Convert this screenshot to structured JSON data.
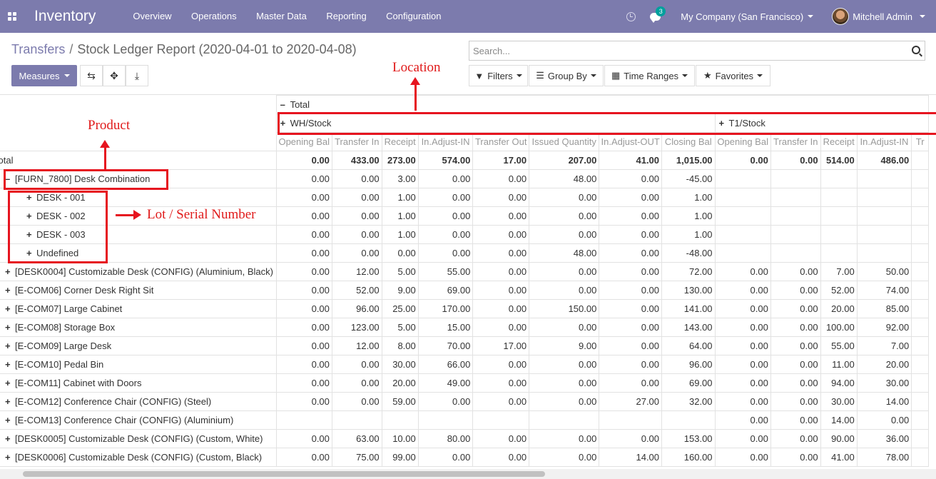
{
  "navbar": {
    "brand": "Inventory",
    "menu": [
      "Overview",
      "Operations",
      "Master Data",
      "Reporting",
      "Configuration"
    ],
    "chat_count": "3",
    "company": "My Company (San Francisco)",
    "user": "Mitchell Admin",
    "colors": {
      "bar": "#7c7bad",
      "badge": "#00a09d"
    }
  },
  "breadcrumb": {
    "parent": "Transfers",
    "sep": "/",
    "current": "Stock Ledger Report (2020-04-01 to 2020-04-08)"
  },
  "search": {
    "placeholder": "Search..."
  },
  "buttons": {
    "measures": "Measures",
    "filters": "Filters",
    "group_by": "Group By",
    "time_ranges": "Time Ranges",
    "favorites": "Favorites"
  },
  "annotations": {
    "location": "Location",
    "product": "Product",
    "lot": "Lot / Serial Number",
    "color": "#e6141f"
  },
  "pivot": {
    "total_header": "Total",
    "locations": [
      "WH/Stock",
      "T1/Stock"
    ],
    "measures_wh": [
      "Opening Bal",
      "Transfer In",
      "Receipt",
      "In.Adjust-IN",
      "Transfer Out",
      "Issued Quantity",
      "In.Adjust-OUT",
      "Closing Bal"
    ],
    "measures_t1": [
      "Opening Bal",
      "Transfer In",
      "Receipt",
      "In.Adjust-IN",
      "Tr"
    ],
    "total_row": {
      "label": "Total",
      "wh": [
        "0.00",
        "433.00",
        "273.00",
        "574.00",
        "17.00",
        "207.00",
        "41.00",
        "1,015.00"
      ],
      "t1": [
        "0.00",
        "0.00",
        "514.00",
        "486.00",
        ""
      ]
    },
    "rows": [
      {
        "label": "[FURN_7800] Desk Combination",
        "expanded": true,
        "level": 0,
        "wh": [
          "0.00",
          "0.00",
          "3.00",
          "0.00",
          "0.00",
          "48.00",
          "0.00",
          "-45.00"
        ],
        "t1": [
          "",
          "",
          "",
          "",
          ""
        ]
      },
      {
        "label": "DESK - 001",
        "level": 1,
        "wh": [
          "0.00",
          "0.00",
          "1.00",
          "0.00",
          "0.00",
          "0.00",
          "0.00",
          "1.00"
        ],
        "t1": [
          "",
          "",
          "",
          "",
          ""
        ]
      },
      {
        "label": "DESK - 002",
        "level": 1,
        "wh": [
          "0.00",
          "0.00",
          "1.00",
          "0.00",
          "0.00",
          "0.00",
          "0.00",
          "1.00"
        ],
        "t1": [
          "",
          "",
          "",
          "",
          ""
        ]
      },
      {
        "label": "DESK - 003",
        "level": 1,
        "wh": [
          "0.00",
          "0.00",
          "1.00",
          "0.00",
          "0.00",
          "0.00",
          "0.00",
          "1.00"
        ],
        "t1": [
          "",
          "",
          "",
          "",
          ""
        ]
      },
      {
        "label": "Undefined",
        "level": 1,
        "wh": [
          "0.00",
          "0.00",
          "0.00",
          "0.00",
          "0.00",
          "48.00",
          "0.00",
          "-48.00"
        ],
        "t1": [
          "",
          "",
          "",
          "",
          ""
        ]
      },
      {
        "label": "[DESK0004] Customizable Desk (CONFIG) (Aluminium, Black)",
        "level": 0,
        "wh": [
          "0.00",
          "12.00",
          "5.00",
          "55.00",
          "0.00",
          "0.00",
          "0.00",
          "72.00"
        ],
        "t1": [
          "0.00",
          "0.00",
          "7.00",
          "50.00",
          ""
        ]
      },
      {
        "label": "[E-COM06] Corner Desk Right Sit",
        "level": 0,
        "wh": [
          "0.00",
          "52.00",
          "9.00",
          "69.00",
          "0.00",
          "0.00",
          "0.00",
          "130.00"
        ],
        "t1": [
          "0.00",
          "0.00",
          "52.00",
          "74.00",
          ""
        ]
      },
      {
        "label": "[E-COM07] Large Cabinet",
        "level": 0,
        "wh": [
          "0.00",
          "96.00",
          "25.00",
          "170.00",
          "0.00",
          "150.00",
          "0.00",
          "141.00"
        ],
        "t1": [
          "0.00",
          "0.00",
          "20.00",
          "85.00",
          ""
        ]
      },
      {
        "label": "[E-COM08] Storage Box",
        "level": 0,
        "wh": [
          "0.00",
          "123.00",
          "5.00",
          "15.00",
          "0.00",
          "0.00",
          "0.00",
          "143.00"
        ],
        "t1": [
          "0.00",
          "0.00",
          "100.00",
          "92.00",
          ""
        ]
      },
      {
        "label": "[E-COM09] Large Desk",
        "level": 0,
        "wh": [
          "0.00",
          "12.00",
          "8.00",
          "70.00",
          "17.00",
          "9.00",
          "0.00",
          "64.00"
        ],
        "t1": [
          "0.00",
          "0.00",
          "55.00",
          "7.00",
          ""
        ]
      },
      {
        "label": "[E-COM10] Pedal Bin",
        "level": 0,
        "wh": [
          "0.00",
          "0.00",
          "30.00",
          "66.00",
          "0.00",
          "0.00",
          "0.00",
          "96.00"
        ],
        "t1": [
          "0.00",
          "0.00",
          "11.00",
          "20.00",
          ""
        ]
      },
      {
        "label": "[E-COM11] Cabinet with Doors",
        "level": 0,
        "wh": [
          "0.00",
          "0.00",
          "20.00",
          "49.00",
          "0.00",
          "0.00",
          "0.00",
          "69.00"
        ],
        "t1": [
          "0.00",
          "0.00",
          "94.00",
          "30.00",
          ""
        ]
      },
      {
        "label": "[E-COM12] Conference Chair (CONFIG) (Steel)",
        "level": 0,
        "wh": [
          "0.00",
          "0.00",
          "59.00",
          "0.00",
          "0.00",
          "0.00",
          "27.00",
          "32.00"
        ],
        "t1": [
          "0.00",
          "0.00",
          "30.00",
          "14.00",
          ""
        ]
      },
      {
        "label": "[E-COM13] Conference Chair (CONFIG) (Aluminium)",
        "level": 0,
        "wh": [
          "",
          "",
          "",
          "",
          "",
          "",
          "",
          ""
        ],
        "t1": [
          "0.00",
          "0.00",
          "14.00",
          "0.00",
          ""
        ]
      },
      {
        "label": "[DESK0005] Customizable Desk (CONFIG) (Custom, White)",
        "level": 0,
        "wh": [
          "0.00",
          "63.00",
          "10.00",
          "80.00",
          "0.00",
          "0.00",
          "0.00",
          "153.00"
        ],
        "t1": [
          "0.00",
          "0.00",
          "90.00",
          "36.00",
          ""
        ]
      },
      {
        "label": "[DESK0006] Customizable Desk (CONFIG) (Custom, Black)",
        "level": 0,
        "wh": [
          "0.00",
          "75.00",
          "99.00",
          "0.00",
          "0.00",
          "0.00",
          "14.00",
          "160.00"
        ],
        "t1": [
          "0.00",
          "0.00",
          "41.00",
          "78.00",
          ""
        ]
      }
    ]
  }
}
